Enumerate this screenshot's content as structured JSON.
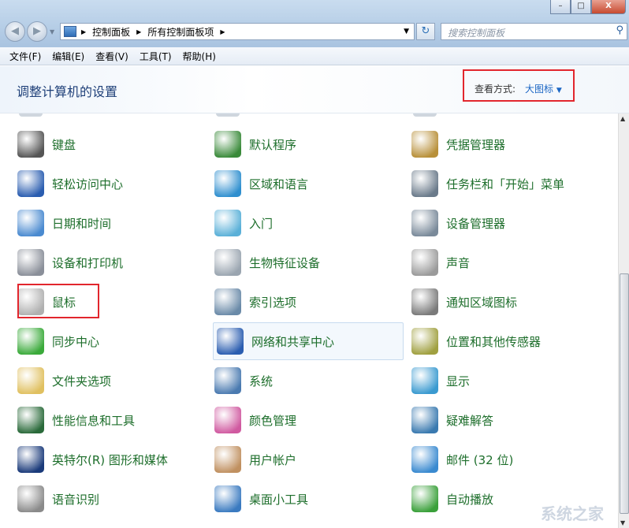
{
  "window": {
    "minimize": "–",
    "maximize": "□",
    "close": "X"
  },
  "address": {
    "crumbs": [
      "控制面板",
      "所有控制面板项"
    ]
  },
  "search": {
    "placeholder": "搜索控制面板"
  },
  "menu": [
    "文件(F)",
    "编辑(E)",
    "查看(V)",
    "工具(T)",
    "帮助(H)"
  ],
  "header": {
    "title": "调整计算机的设置",
    "view_by_label": "查看方式:",
    "view_by_value": "大图标"
  },
  "items": [
    {
      "label": "键盘",
      "icon": "keyboard-icon",
      "color": "#555"
    },
    {
      "label": "默认程序",
      "icon": "default-programs-icon",
      "color": "#3a8a3a"
    },
    {
      "label": "凭据管理器",
      "icon": "credential-manager-icon",
      "color": "#b8903a"
    },
    {
      "label": "轻松访问中心",
      "icon": "ease-of-access-icon",
      "color": "#2a5db0"
    },
    {
      "label": "区域和语言",
      "icon": "region-language-icon",
      "color": "#2f8fcf"
    },
    {
      "label": "任务栏和「开始」菜单",
      "icon": "taskbar-icon",
      "color": "#6a7a8a"
    },
    {
      "label": "日期和时间",
      "icon": "date-time-icon",
      "color": "#4a8ad0"
    },
    {
      "label": "入门",
      "icon": "getting-started-icon",
      "color": "#5ab0d8"
    },
    {
      "label": "设备管理器",
      "icon": "device-manager-icon",
      "color": "#7a8a9a"
    },
    {
      "label": "设备和打印机",
      "icon": "devices-printers-icon",
      "color": "#8a8f99"
    },
    {
      "label": "生物特征设备",
      "icon": "biometric-icon",
      "color": "#9aa5b0"
    },
    {
      "label": "声音",
      "icon": "sound-icon",
      "color": "#9a9a9a"
    },
    {
      "label": "鼠标",
      "icon": "mouse-icon",
      "color": "#b0b0b0"
    },
    {
      "label": "索引选项",
      "icon": "indexing-icon",
      "color": "#6a8aa8"
    },
    {
      "label": "通知区域图标",
      "icon": "notification-area-icon",
      "color": "#7a7a7a"
    },
    {
      "label": "同步中心",
      "icon": "sync-center-icon",
      "color": "#3aaa3a"
    },
    {
      "label": "网络和共享中心",
      "icon": "network-sharing-icon",
      "color": "#2a5db0"
    },
    {
      "label": "位置和其他传感器",
      "icon": "location-sensors-icon",
      "color": "#a0a040"
    },
    {
      "label": "文件夹选项",
      "icon": "folder-options-icon",
      "color": "#e0c060"
    },
    {
      "label": "系统",
      "icon": "system-icon",
      "color": "#4a7ab0"
    },
    {
      "label": "显示",
      "icon": "display-icon",
      "color": "#3a9ad0"
    },
    {
      "label": "性能信息和工具",
      "icon": "performance-icon",
      "color": "#2a6a3a"
    },
    {
      "label": "颜色管理",
      "icon": "color-management-icon",
      "color": "#d05aa0"
    },
    {
      "label": "疑难解答",
      "icon": "troubleshooting-icon",
      "color": "#3a7ab0"
    },
    {
      "label": "英特尔(R) 图形和媒体",
      "icon": "intel-graphics-icon",
      "color": "#1a3a7a"
    },
    {
      "label": "用户帐户",
      "icon": "user-accounts-icon",
      "color": "#c09060"
    },
    {
      "label": "邮件 (32 位)",
      "icon": "mail-icon",
      "color": "#3a8ad0"
    },
    {
      "label": "语音识别",
      "icon": "speech-recognition-icon",
      "color": "#8a8a8a"
    },
    {
      "label": "桌面小工具",
      "icon": "desktop-gadgets-icon",
      "color": "#3a7ac0"
    },
    {
      "label": "自动播放",
      "icon": "autoplay-icon",
      "color": "#3aa03a"
    }
  ],
  "watermark": "系统之家"
}
